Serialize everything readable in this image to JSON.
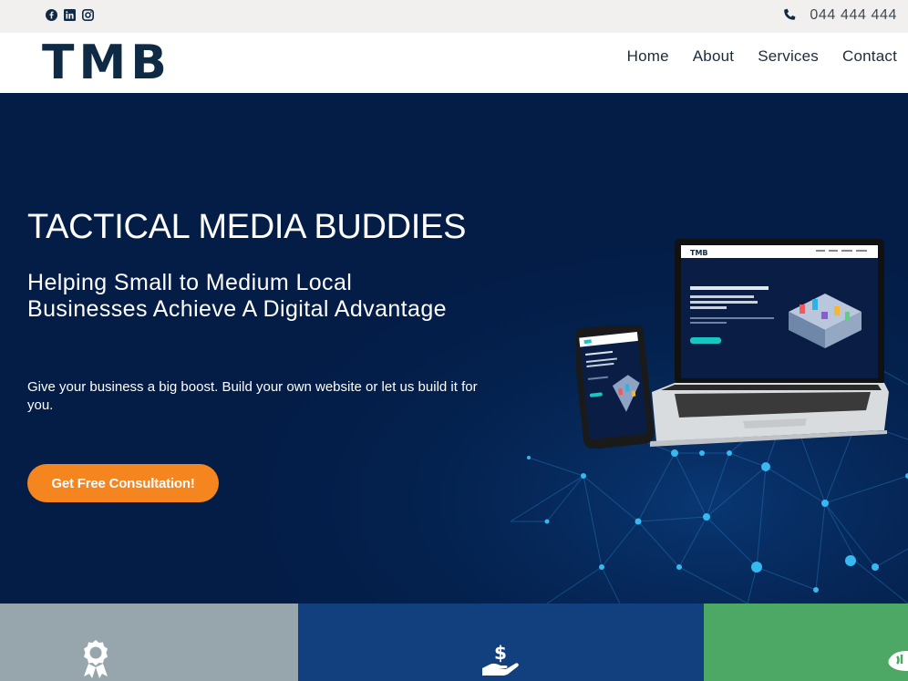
{
  "topbar": {
    "social": [
      "facebook-icon",
      "linkedin-icon",
      "instagram-icon"
    ],
    "phone": "044 444 444"
  },
  "header": {
    "logo": "TMB",
    "nav": [
      "Home",
      "About",
      "Services",
      "Contact"
    ]
  },
  "hero": {
    "title": "TACTICAL MEDIA BUDDIES",
    "subtitle": "Helping Small to Medium Local Businesses Achieve A Digital Advantage",
    "text": "Give your business a big boost. Build your own website or let us build it for you.",
    "cta": "Get Free Consultation!"
  },
  "features": {
    "icons": [
      "award-icon",
      "money-hand-icon",
      "handshake-icon"
    ]
  },
  "colors": {
    "navy": "#031d47",
    "orange": "#f5861f",
    "grey": "#97a6ac",
    "blue": "#12407f",
    "green": "#4da865"
  }
}
